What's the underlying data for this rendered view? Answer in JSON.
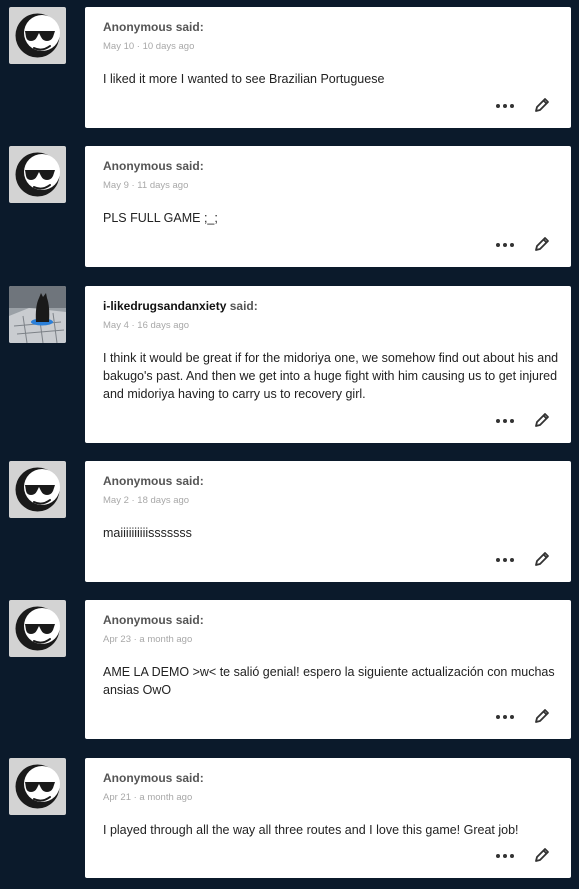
{
  "said_label": "said:",
  "icons": {
    "avatar": "sunglasses-smiley-avatar",
    "photo_avatar": "cat-photo-avatar",
    "more": "more-dots-icon",
    "edit": "pencil-icon"
  },
  "comments": [
    {
      "author": "Anonymous",
      "date": "May 10 · 10 days ago",
      "text": "I liked it more I wanted to see Brazilian Portuguese"
    },
    {
      "author": "Anonymous",
      "date": "May 9 · 11 days ago",
      "text": "PLS FULL GAME ;_;"
    },
    {
      "author": "i-likedrugsandanxiety",
      "date": "May 4 · 16 days ago",
      "text": "I think it would be great if for the midoriya one, we somehow find out about his and bakugo's past. And then we get into a huge fight with him causing us to get injured and midoriya having to carry us to recovery girl."
    },
    {
      "author": "Anonymous",
      "date": "May 2 · 18 days ago",
      "text": "maiiiiiiiiiisssssss"
    },
    {
      "author": "Anonymous",
      "date": "Apr 23 · a month ago",
      "text": "AME LA DEMO >w< te salió genial! espero la siguiente actualización con muchas ansias OwO"
    },
    {
      "author": "Anonymous",
      "date": "Apr 21 · a month ago",
      "text": "I played through all the way all three routes and I love this game! Great job!"
    }
  ]
}
